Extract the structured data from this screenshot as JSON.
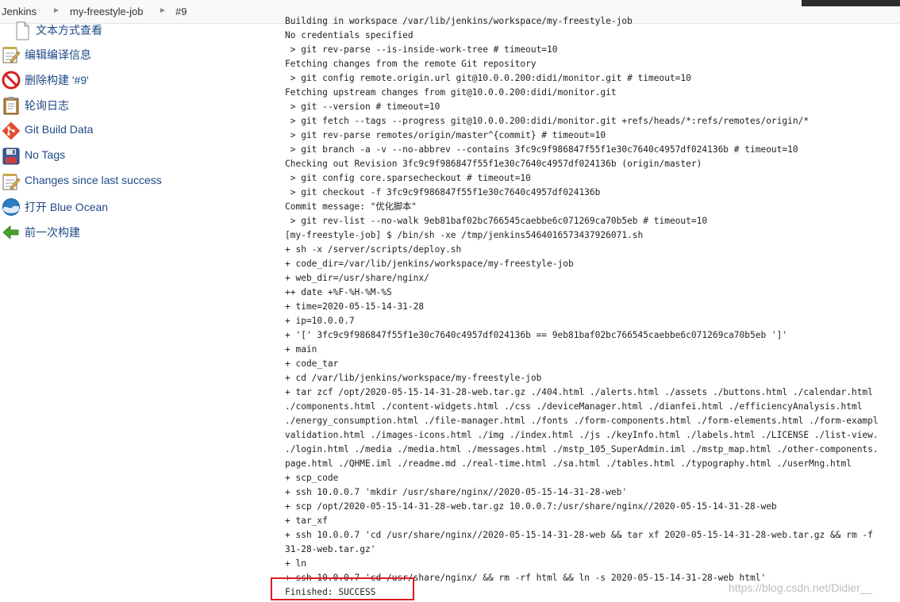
{
  "breadcrumb": {
    "items": [
      "Jenkins",
      "my-freestyle-job",
      "#9"
    ]
  },
  "sidebar": {
    "items": [
      {
        "label": "文本方式查看",
        "icon": "document-icon"
      },
      {
        "label": "编辑编译信息",
        "icon": "notepad-edit-icon"
      },
      {
        "label": "删除构建 '#9'",
        "icon": "no-entry-icon"
      },
      {
        "label": "轮询日志",
        "icon": "clipboard-icon"
      },
      {
        "label": "Git Build Data",
        "icon": "git-icon"
      },
      {
        "label": "No Tags",
        "icon": "floppy-disk-icon"
      },
      {
        "label": "Changes since last success",
        "icon": "notepad-edit-icon"
      },
      {
        "label": "打开 Blue Ocean",
        "icon": "blue-ocean-icon"
      },
      {
        "label": "前一次构建",
        "icon": "arrow-left-icon"
      }
    ]
  },
  "console": {
    "lines": [
      "Building in workspace /var/lib/jenkins/workspace/my-freestyle-job",
      "No credentials specified",
      " > git rev-parse --is-inside-work-tree # timeout=10",
      "Fetching changes from the remote Git repository",
      " > git config remote.origin.url git@10.0.0.200:didi/monitor.git # timeout=10",
      "Fetching upstream changes from git@10.0.0.200:didi/monitor.git",
      " > git --version # timeout=10",
      " > git fetch --tags --progress git@10.0.0.200:didi/monitor.git +refs/heads/*:refs/remotes/origin/*",
      " > git rev-parse remotes/origin/master^{commit} # timeout=10",
      " > git branch -a -v --no-abbrev --contains 3fc9c9f986847f55f1e30c7640c4957df024136b # timeout=10",
      "Checking out Revision 3fc9c9f986847f55f1e30c7640c4957df024136b (origin/master)",
      " > git config core.sparsecheckout # timeout=10",
      " > git checkout -f 3fc9c9f986847f55f1e30c7640c4957df024136b",
      "Commit message: \"优化脚本\"",
      " > git rev-list --no-walk 9eb81baf02bc766545caebbe6c071269ca70b5eb # timeout=10",
      "[my-freestyle-job] $ /bin/sh -xe /tmp/jenkins5464016573437926071.sh",
      "+ sh -x /server/scripts/deploy.sh",
      "+ code_dir=/var/lib/jenkins/workspace/my-freestyle-job",
      "+ web_dir=/usr/share/nginx/",
      "++ date +%F-%H-%M-%S",
      "+ time=2020-05-15-14-31-28",
      "+ ip=10.0.0.7",
      "+ '[' 3fc9c9f986847f55f1e30c7640c4957df024136b == 9eb81baf02bc766545caebbe6c071269ca70b5eb ']'",
      "+ main",
      "+ code_tar",
      "+ cd /var/lib/jenkins/workspace/my-freestyle-job",
      "+ tar zcf /opt/2020-05-15-14-31-28-web.tar.gz ./404.html ./alerts.html ./assets ./buttons.html ./calendar.html",
      "./components.html ./content-widgets.html ./css ./deviceManager.html ./dianfei.html ./efficiencyAnalysis.html",
      "./energy_consumption.html ./file-manager.html ./fonts ./form-components.html ./form-elements.html ./form-exampl",
      "validation.html ./images-icons.html ./img ./index.html ./js ./keyInfo.html ./labels.html ./LICENSE ./list-view.",
      "./login.html ./media ./media.html ./messages.html ./mstp_105_SuperAdmin.iml ./mstp_map.html ./other-components.",
      "page.html ./QHME.iml ./readme.md ./real-time.html ./sa.html ./tables.html ./typography.html ./userMng.html",
      "+ scp_code",
      "+ ssh 10.0.0.7 'mkdir /usr/share/nginx//2020-05-15-14-31-28-web'",
      "+ scp /opt/2020-05-15-14-31-28-web.tar.gz 10.0.0.7:/usr/share/nginx//2020-05-15-14-31-28-web",
      "+ tar_xf",
      "+ ssh 10.0.0.7 'cd /usr/share/nginx//2020-05-15-14-31-28-web && tar xf 2020-05-15-14-31-28-web.tar.gz && rm -f",
      "31-28-web.tar.gz'",
      "+ ln",
      "+ ssh 10.0.0.7 'cd /usr/share/nginx/ && rm -rf html && ln -s 2020-05-15-14-31-28-web html'",
      "Finished: SUCCESS"
    ]
  },
  "watermark": "https://blog.csdn.net/Didier__"
}
